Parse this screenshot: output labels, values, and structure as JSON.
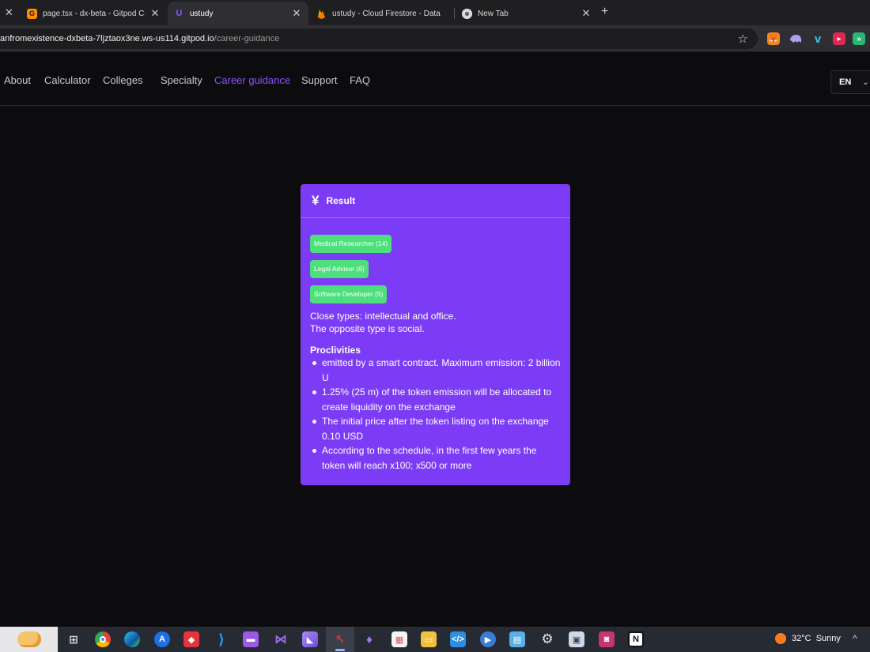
{
  "browser": {
    "tabs": [
      {
        "title": "page.tsx - dx-beta - Gitpod Co",
        "favicon": "gitpod-icon",
        "favicon_color": "#ff8a00"
      },
      {
        "title": "ustudy",
        "favicon": "ustudy-icon",
        "favicon_color": "#8b52ff",
        "active": true
      },
      {
        "title": "ustudy - Cloud Firestore - Data",
        "favicon": "firebase-icon",
        "favicon_color": "#ffa000"
      },
      {
        "title": "New Tab",
        "favicon": "chrome-icon",
        "favicon_color": "#dddddd"
      }
    ],
    "new_tab_label": "+",
    "close_glyph": "✕",
    "url_host": "anfromexistence-dxbeta-7ljztaox3ne.ws-us114.gitpod.io",
    "url_path": "/career-guidance",
    "bookmark_glyph": "☆"
  },
  "nav": {
    "items": [
      {
        "label": "About"
      },
      {
        "label": "Calculator"
      },
      {
        "label": "Colleges"
      },
      {
        "label": "Specialty"
      },
      {
        "label": "Career guidance",
        "active": true
      },
      {
        "label": "Support"
      },
      {
        "label": "FAQ"
      }
    ],
    "language": "EN",
    "language_chevron": "⌄"
  },
  "result": {
    "icon_glyph": "¥",
    "title": "Result",
    "badges": [
      "Medical Researcher (14)",
      "Legal Advisor (6)",
      "Software Developer (5)"
    ],
    "close_types": "Close types: intellectual and office.",
    "opposite_type": "The opposite type is social.",
    "proclivities_title": "Proclivities",
    "proclivities": [
      "emitted by a smart contract. Maximum emission: 2 billion U",
      "1.25% (25 m) of the token emission will be allocated to create liquidity on the exchange",
      "The initial price after the token listing on the exchange 0.10 USD",
      "According to the schedule, in the first few years the token will reach x100; x500 or more"
    ],
    "colors": {
      "card": "#7c3cf5",
      "badge": "#4cdf7c",
      "accent": "#8b52ff"
    }
  },
  "taskbar": {
    "weather_temp": "32°C",
    "weather_desc": "Sunny",
    "tray_caret": "^"
  }
}
